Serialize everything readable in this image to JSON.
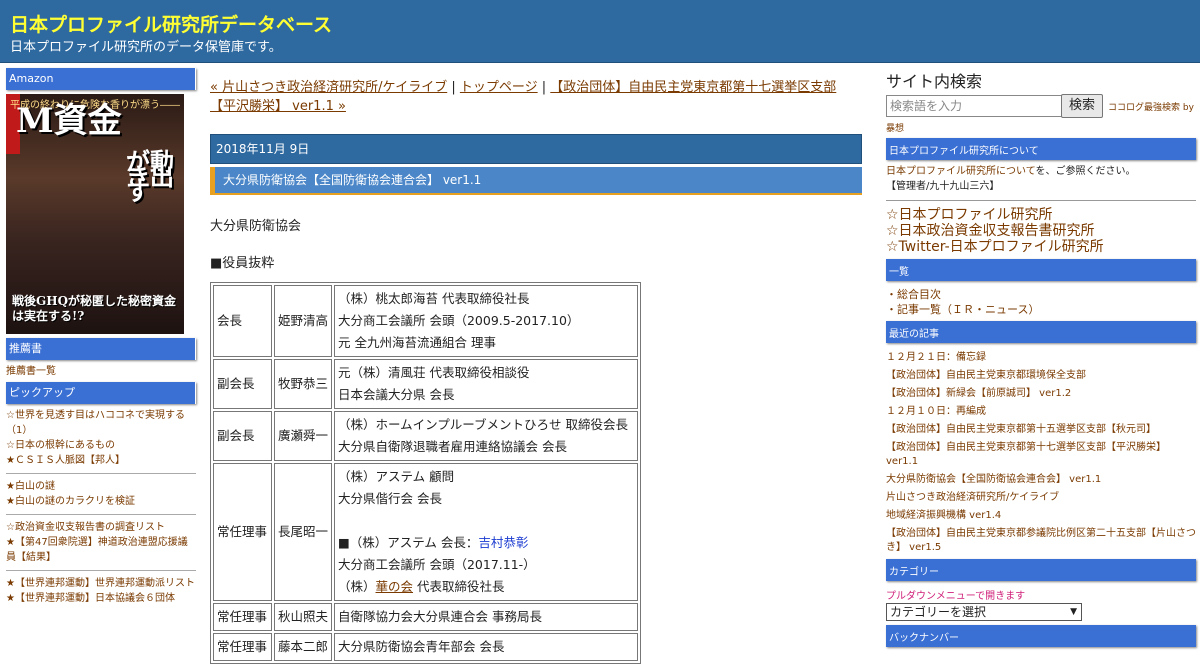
{
  "header": {
    "title": "日本プロファイル研究所データベース",
    "description": "日本プロファイル研究所のデータ保管庫です。"
  },
  "left": {
    "amazon_heading": "Amazon",
    "book": {
      "top_text": "平成の終わりに危険な香りが漂う――",
      "main_title": "M資金",
      "sub_title": "が動き出す",
      "bottom_text": "戦後GHQが秘匿した秘密資金は実在する!?"
    },
    "recommend_heading": "推薦書",
    "recommend_link": "推薦書一覧",
    "pickup_heading": "ピックアップ",
    "group1": [
      "☆世界を見透す目はハココネで実現する（1）",
      "☆日本の根幹にあるもの",
      "★ＣＳＩＳ人脈図【邦人】"
    ],
    "group2": [
      "★白山の謎",
      "★白山の謎のカラクリを検証"
    ],
    "group3": [
      "☆政治資金収支報告書の調査リスト",
      "★【第47回衆院選】神道政治連盟応援議員【結果】"
    ],
    "group4": [
      "★【世界連邦運動】世界連邦運動派リスト",
      "★【世界連邦運動】日本協議会６団体"
    ]
  },
  "main": {
    "nav": {
      "prev": "« 片山さつき政治経済研究所/ケイライブ",
      "sep1": " | ",
      "top": "トップページ",
      "sep2": " | ",
      "next": "【政治団体】自由民主党東京都第十七選挙区支部【平沢勝栄】 ver1.1 »"
    },
    "date": "2018年11月 9日",
    "entry_title": "大分県防衛協会【全国防衛協会連合会】 ver1.1",
    "intro": "大分県防衛協会",
    "section": "■役員抜粋",
    "officers": [
      {
        "role": "会長",
        "name": "姫野清高",
        "lines": [
          "（株）桃太郎海苔 代表取締役社長",
          "大分商工会議所 会頭（2009.5-2017.10）",
          "元 全九州海苔流通組合 理事"
        ]
      },
      {
        "role": "副会長",
        "name": "牧野恭三",
        "lines": [
          "元（株）清風荘 代表取締役相談役",
          "日本会議大分県 会長"
        ]
      },
      {
        "role": "副会長",
        "name": "廣瀬舜一",
        "lines": [
          "（株）ホームインプルーブメントひろせ 取締役会長",
          "大分県自衛隊退職者雇用連絡協議会 会長"
        ]
      },
      {
        "role": "常任理事",
        "name": "長尾昭一",
        "lines": [
          "（株）アステム 顧問",
          "大分県偕行会 会長",
          "",
          "■（株）アステム 会長：",
          "大分商工会議所 会頭（2017.11-）",
          "（株）"
        ],
        "link1": "吉村恭彰",
        "link2": "華の会",
        "tail": " 代表取締役社長"
      },
      {
        "role": "常任理事",
        "name": "秋山照夫",
        "lines": [
          "自衛隊協力会大分県連合会 事務局長"
        ]
      },
      {
        "role": "常任理事",
        "name": "藤本二郎",
        "lines": [
          "大分県防衛協会青年部会 会長"
        ]
      }
    ]
  },
  "right": {
    "search_heading": "サイト内検索",
    "search_placeholder": "検索語を入力",
    "search_button": "検索",
    "search_by": "ココログ最強検索 by",
    "search_by2": "暴想",
    "about_heading": "日本プロファイル研究所について",
    "about_link": "日本プロファイル研究所について",
    "about_text": "を、ご参照ください。",
    "admin": "【管理者/九十九山三六】",
    "big_links": [
      "☆日本プロファイル研究所",
      "☆日本政治資金収支報告書研究所",
      "☆Twitter-日本プロファイル研究所"
    ],
    "list_heading": "一覧",
    "list_items": [
      "・総合目次",
      "・記事一覧（ＩＲ・ニュース）"
    ],
    "recent_heading": "最近の記事",
    "recent_items": [
      "１２月２１日：備忘録",
      "【政治団体】自由民主党東京都環境保全支部",
      "【政治団体】新緑会【前原誠司】 ver1.2",
      "１２月１０日：再編成",
      "【政治団体】自由民主党東京都第十五選挙区支部【秋元司】",
      "【政治団体】自由民主党東京都第十七選挙区支部【平沢勝栄】 ver1.1",
      "大分県防衛協会【全国防衛協会連合会】 ver1.1",
      "片山さつき政治経済研究所/ケイライブ",
      "地域経済振興機構 ver1.4",
      "【政治団体】自由民主党東京都参議院比例区第二十五支部【片山さつき】 ver1.5"
    ],
    "category_heading": "カテゴリー",
    "pulldown_note": "プルダウンメニューで開きます",
    "category_select": "カテゴリーを選択",
    "backnumber_heading": "バックナンバー"
  }
}
